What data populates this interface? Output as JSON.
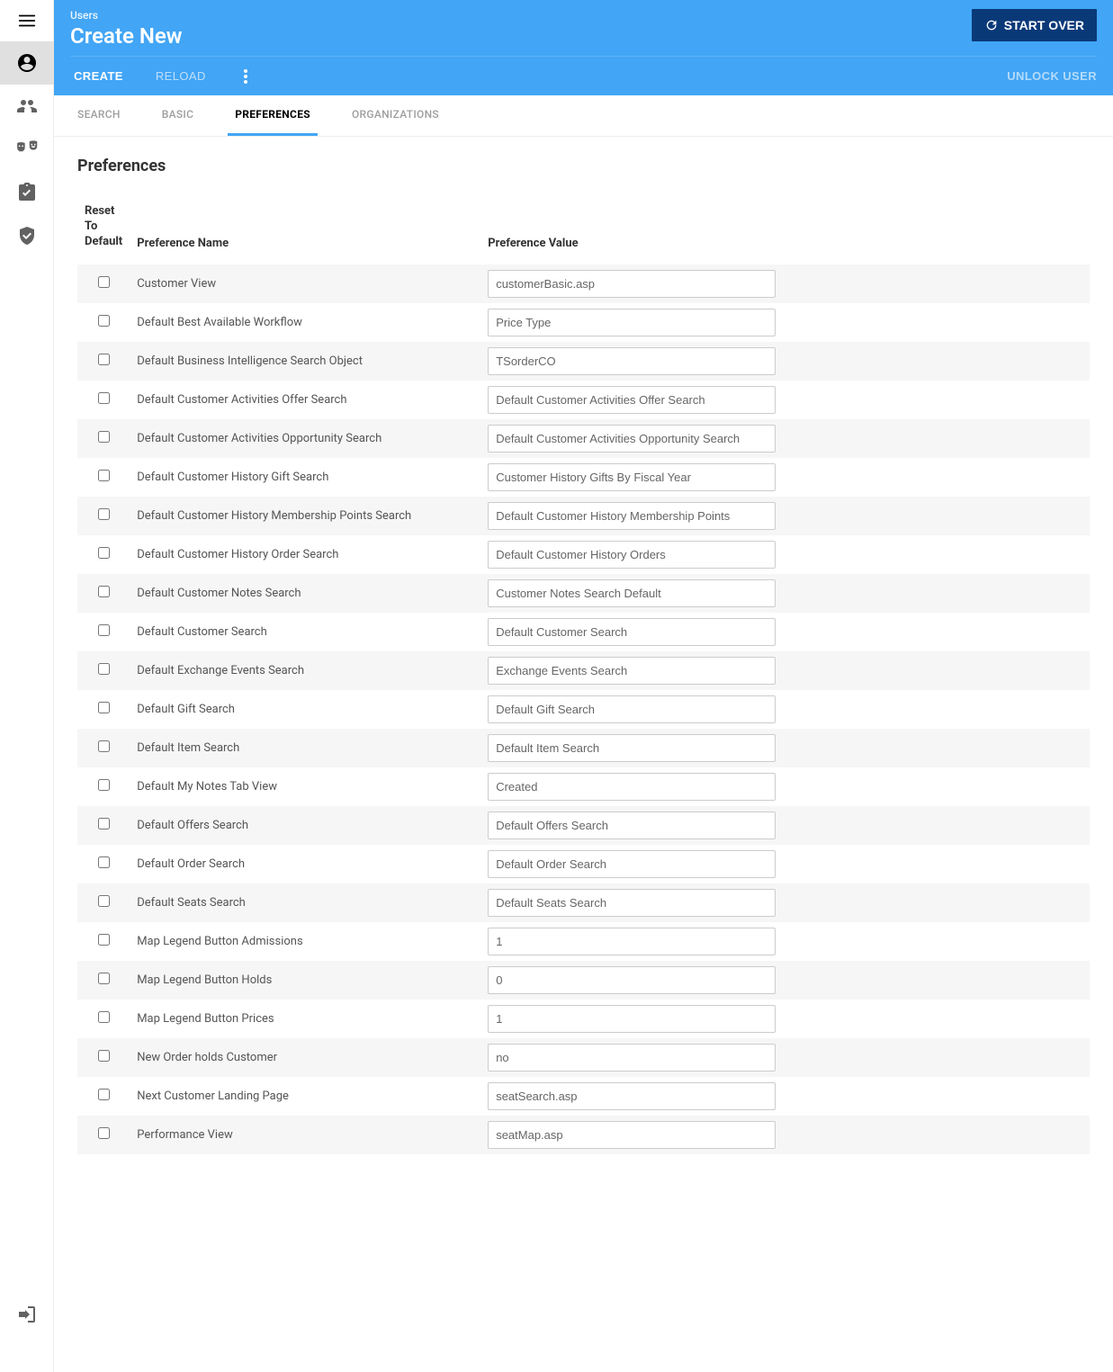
{
  "header": {
    "subtitle": "Users",
    "title": "Create New",
    "start_over_label": "START OVER"
  },
  "actions": {
    "create": "CREATE",
    "reload": "RELOAD",
    "unlock": "UNLOCK USER"
  },
  "tabs": [
    {
      "label": "SEARCH",
      "active": false
    },
    {
      "label": "BASIC",
      "active": false
    },
    {
      "label": "PREFERENCES",
      "active": true
    },
    {
      "label": "ORGANIZATIONS",
      "active": false
    }
  ],
  "content": {
    "heading": "Preferences",
    "columns": {
      "reset": "Reset To Default",
      "name": "Preference Name",
      "value": "Preference Value"
    },
    "rows": [
      {
        "name": "Customer View",
        "value": "customerBasic.asp"
      },
      {
        "name": "Default Best Available Workflow",
        "value": "Price Type"
      },
      {
        "name": "Default Business Intelligence Search Object",
        "value": "TSorderCO"
      },
      {
        "name": "Default Customer Activities Offer Search",
        "value": "Default Customer Activities Offer Search"
      },
      {
        "name": "Default Customer Activities Opportunity Search",
        "value": "Default Customer Activities Opportunity Search"
      },
      {
        "name": "Default Customer History Gift Search",
        "value": "Customer History Gifts By Fiscal Year"
      },
      {
        "name": "Default Customer History Membership Points Search",
        "value": "Default Customer History Membership Points"
      },
      {
        "name": "Default Customer History Order Search",
        "value": "Default Customer History Orders"
      },
      {
        "name": "Default Customer Notes Search",
        "value": "Customer Notes Search Default"
      },
      {
        "name": "Default Customer Search",
        "value": "Default Customer Search"
      },
      {
        "name": "Default Exchange Events Search",
        "value": "Exchange Events Search"
      },
      {
        "name": "Default Gift Search",
        "value": "Default Gift Search"
      },
      {
        "name": "Default Item Search",
        "value": "Default Item Search"
      },
      {
        "name": "Default My Notes Tab View",
        "value": "Created"
      },
      {
        "name": "Default Offers Search",
        "value": "Default Offers Search"
      },
      {
        "name": "Default Order Search",
        "value": "Default Order Search"
      },
      {
        "name": "Default Seats Search",
        "value": "Default Seats Search"
      },
      {
        "name": "Map Legend Button Admissions",
        "value": "1"
      },
      {
        "name": "Map Legend Button Holds",
        "value": "0"
      },
      {
        "name": "Map Legend Button Prices",
        "value": "1"
      },
      {
        "name": "New Order holds Customer",
        "value": "no"
      },
      {
        "name": "Next Customer Landing Page",
        "value": "seatSearch.asp"
      },
      {
        "name": "Performance View",
        "value": "seatMap.asp"
      }
    ]
  }
}
